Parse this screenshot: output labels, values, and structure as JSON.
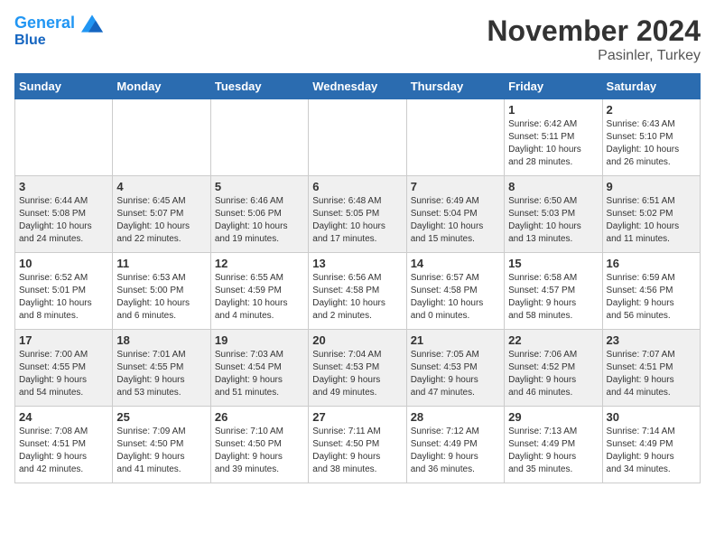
{
  "header": {
    "logo_line1": "General",
    "logo_line2": "Blue",
    "month": "November 2024",
    "location": "Pasinler, Turkey"
  },
  "weekdays": [
    "Sunday",
    "Monday",
    "Tuesday",
    "Wednesday",
    "Thursday",
    "Friday",
    "Saturday"
  ],
  "weeks": [
    [
      {
        "day": "",
        "info": ""
      },
      {
        "day": "",
        "info": ""
      },
      {
        "day": "",
        "info": ""
      },
      {
        "day": "",
        "info": ""
      },
      {
        "day": "",
        "info": ""
      },
      {
        "day": "1",
        "info": "Sunrise: 6:42 AM\nSunset: 5:11 PM\nDaylight: 10 hours\nand 28 minutes."
      },
      {
        "day": "2",
        "info": "Sunrise: 6:43 AM\nSunset: 5:10 PM\nDaylight: 10 hours\nand 26 minutes."
      }
    ],
    [
      {
        "day": "3",
        "info": "Sunrise: 6:44 AM\nSunset: 5:08 PM\nDaylight: 10 hours\nand 24 minutes."
      },
      {
        "day": "4",
        "info": "Sunrise: 6:45 AM\nSunset: 5:07 PM\nDaylight: 10 hours\nand 22 minutes."
      },
      {
        "day": "5",
        "info": "Sunrise: 6:46 AM\nSunset: 5:06 PM\nDaylight: 10 hours\nand 19 minutes."
      },
      {
        "day": "6",
        "info": "Sunrise: 6:48 AM\nSunset: 5:05 PM\nDaylight: 10 hours\nand 17 minutes."
      },
      {
        "day": "7",
        "info": "Sunrise: 6:49 AM\nSunset: 5:04 PM\nDaylight: 10 hours\nand 15 minutes."
      },
      {
        "day": "8",
        "info": "Sunrise: 6:50 AM\nSunset: 5:03 PM\nDaylight: 10 hours\nand 13 minutes."
      },
      {
        "day": "9",
        "info": "Sunrise: 6:51 AM\nSunset: 5:02 PM\nDaylight: 10 hours\nand 11 minutes."
      }
    ],
    [
      {
        "day": "10",
        "info": "Sunrise: 6:52 AM\nSunset: 5:01 PM\nDaylight: 10 hours\nand 8 minutes."
      },
      {
        "day": "11",
        "info": "Sunrise: 6:53 AM\nSunset: 5:00 PM\nDaylight: 10 hours\nand 6 minutes."
      },
      {
        "day": "12",
        "info": "Sunrise: 6:55 AM\nSunset: 4:59 PM\nDaylight: 10 hours\nand 4 minutes."
      },
      {
        "day": "13",
        "info": "Sunrise: 6:56 AM\nSunset: 4:58 PM\nDaylight: 10 hours\nand 2 minutes."
      },
      {
        "day": "14",
        "info": "Sunrise: 6:57 AM\nSunset: 4:58 PM\nDaylight: 10 hours\nand 0 minutes."
      },
      {
        "day": "15",
        "info": "Sunrise: 6:58 AM\nSunset: 4:57 PM\nDaylight: 9 hours\nand 58 minutes."
      },
      {
        "day": "16",
        "info": "Sunrise: 6:59 AM\nSunset: 4:56 PM\nDaylight: 9 hours\nand 56 minutes."
      }
    ],
    [
      {
        "day": "17",
        "info": "Sunrise: 7:00 AM\nSunset: 4:55 PM\nDaylight: 9 hours\nand 54 minutes."
      },
      {
        "day": "18",
        "info": "Sunrise: 7:01 AM\nSunset: 4:55 PM\nDaylight: 9 hours\nand 53 minutes."
      },
      {
        "day": "19",
        "info": "Sunrise: 7:03 AM\nSunset: 4:54 PM\nDaylight: 9 hours\nand 51 minutes."
      },
      {
        "day": "20",
        "info": "Sunrise: 7:04 AM\nSunset: 4:53 PM\nDaylight: 9 hours\nand 49 minutes."
      },
      {
        "day": "21",
        "info": "Sunrise: 7:05 AM\nSunset: 4:53 PM\nDaylight: 9 hours\nand 47 minutes."
      },
      {
        "day": "22",
        "info": "Sunrise: 7:06 AM\nSunset: 4:52 PM\nDaylight: 9 hours\nand 46 minutes."
      },
      {
        "day": "23",
        "info": "Sunrise: 7:07 AM\nSunset: 4:51 PM\nDaylight: 9 hours\nand 44 minutes."
      }
    ],
    [
      {
        "day": "24",
        "info": "Sunrise: 7:08 AM\nSunset: 4:51 PM\nDaylight: 9 hours\nand 42 minutes."
      },
      {
        "day": "25",
        "info": "Sunrise: 7:09 AM\nSunset: 4:50 PM\nDaylight: 9 hours\nand 41 minutes."
      },
      {
        "day": "26",
        "info": "Sunrise: 7:10 AM\nSunset: 4:50 PM\nDaylight: 9 hours\nand 39 minutes."
      },
      {
        "day": "27",
        "info": "Sunrise: 7:11 AM\nSunset: 4:50 PM\nDaylight: 9 hours\nand 38 minutes."
      },
      {
        "day": "28",
        "info": "Sunrise: 7:12 AM\nSunset: 4:49 PM\nDaylight: 9 hours\nand 36 minutes."
      },
      {
        "day": "29",
        "info": "Sunrise: 7:13 AM\nSunset: 4:49 PM\nDaylight: 9 hours\nand 35 minutes."
      },
      {
        "day": "30",
        "info": "Sunrise: 7:14 AM\nSunset: 4:49 PM\nDaylight: 9 hours\nand 34 minutes."
      }
    ]
  ]
}
